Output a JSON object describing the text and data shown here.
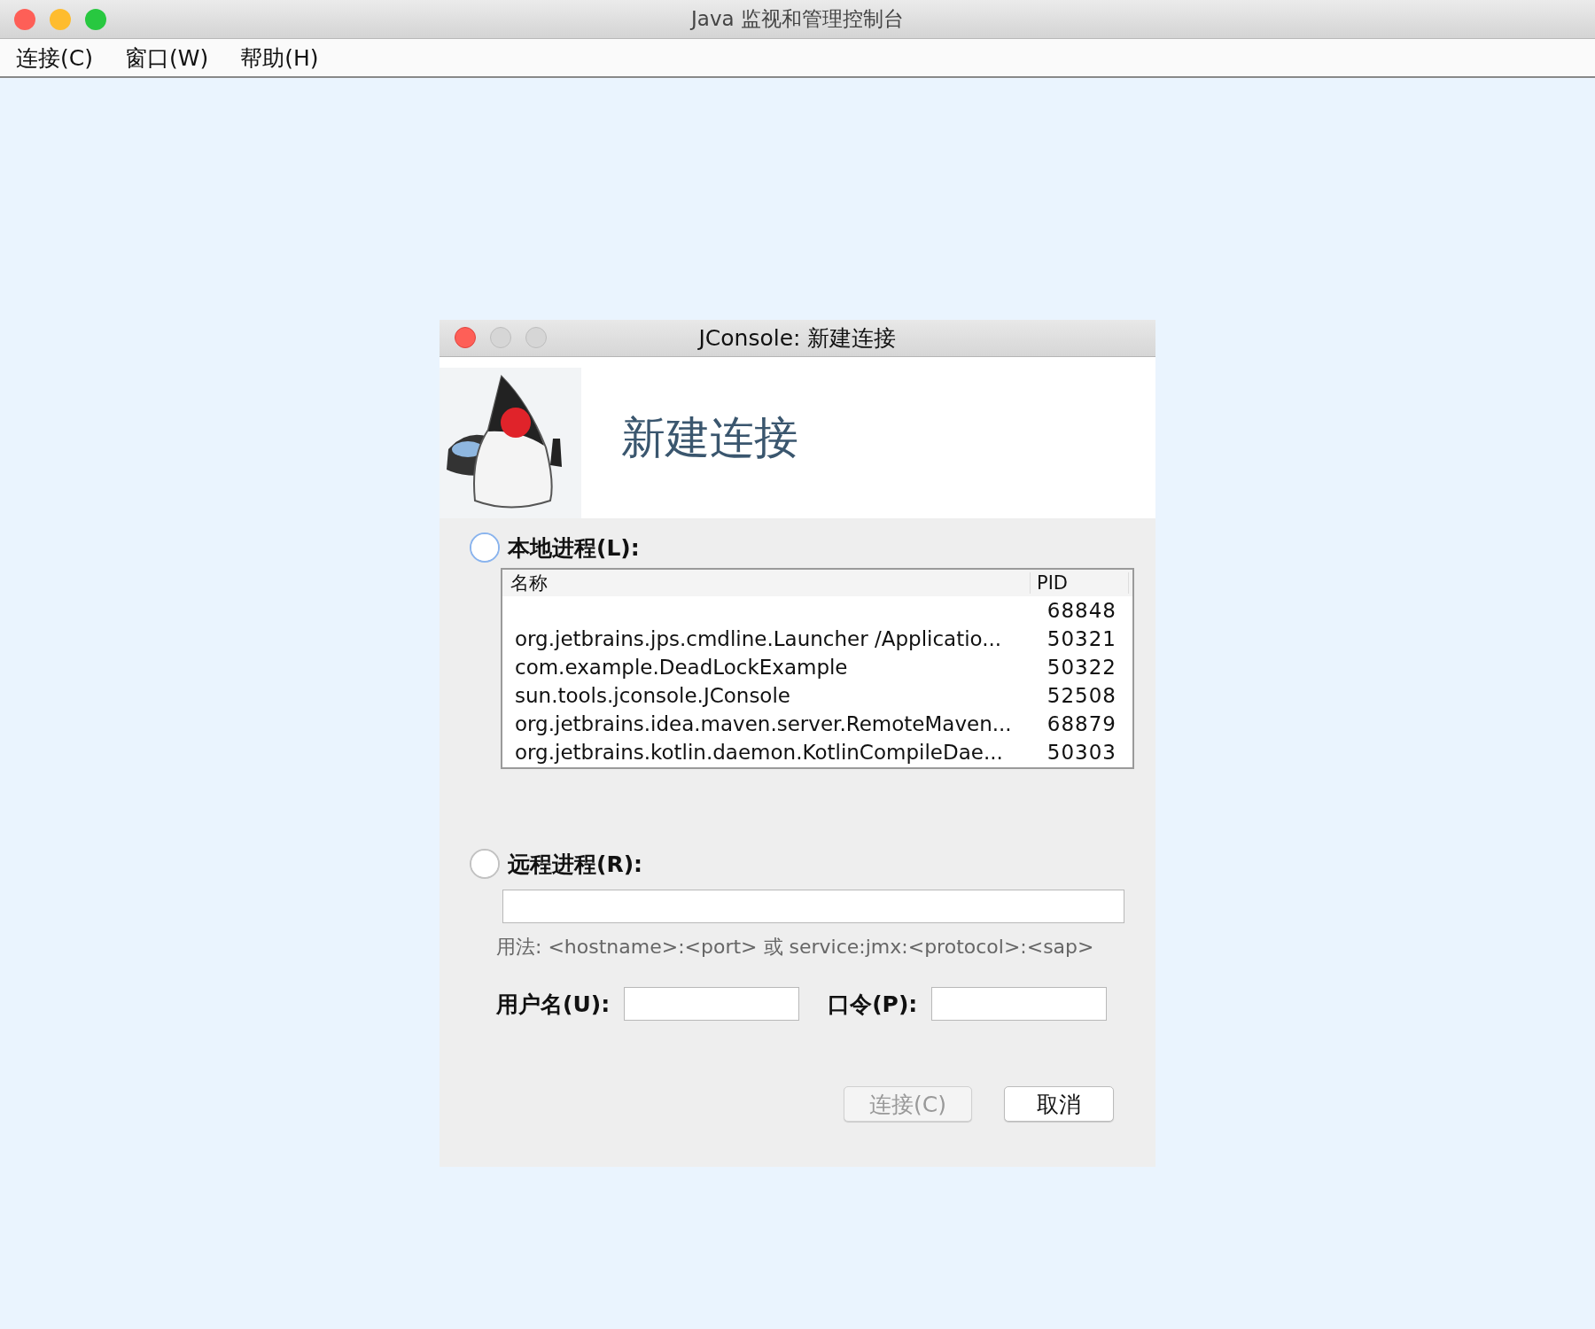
{
  "window": {
    "title": "Java 监视和管理控制台"
  },
  "menu": [
    "连接(C)",
    "窗口(W)",
    "帮助(H)"
  ],
  "dialog": {
    "title": "JConsole: 新建连接",
    "heading": "新建连接",
    "local": {
      "label": "本地进程(L):",
      "selected": false,
      "focused": true,
      "table": {
        "columns": [
          "名称",
          "PID"
        ],
        "rows": [
          {
            "pid": "68848"
          },
          {
            "name": "org.jetbrains.jps.cmdline.Launcher /Applicatio...",
            "pid": "50321"
          },
          {
            "name": "com.example.DeadLockExample",
            "pid": "50322"
          },
          {
            "name": "sun.tools.jconsole.JConsole",
            "pid": "52508"
          },
          {
            "name": "org.jetbrains.idea.maven.server.RemoteMaven...",
            "pid": "68879"
          },
          {
            "name": "org.jetbrains.kotlin.daemon.KotlinCompileDae...",
            "pid": "50303"
          }
        ]
      }
    },
    "remote": {
      "label": "远程进程(R):",
      "selected": false,
      "focused": false,
      "usage": "用法: <hostname>:<port> 或 service:jmx:<protocol>:<sap>"
    },
    "username_label": "用户名(U):",
    "password_label": "口令(P):",
    "buttons": [
      {
        "label": "连接(C)",
        "disabled": true
      },
      {
        "label": "取消",
        "disabled": false
      }
    ]
  }
}
